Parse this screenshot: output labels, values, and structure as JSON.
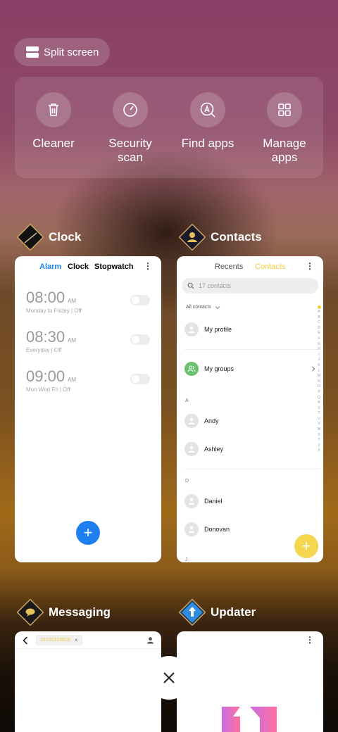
{
  "split_screen": {
    "label": "Split screen"
  },
  "tools": [
    {
      "label": "Cleaner",
      "icon": "trash-icon"
    },
    {
      "label": "Security\nscan",
      "icon": "gauge-icon"
    },
    {
      "label": "Find apps",
      "icon": "find-apps-icon"
    },
    {
      "label": "Manage\napps",
      "icon": "grid-icon"
    }
  ],
  "apps": {
    "clock": {
      "title": "Clock",
      "tabs": [
        "Alarm",
        "Clock",
        "Stopwatch"
      ],
      "alarms": [
        {
          "time": "08:00",
          "ampm": "AM",
          "days": "Monday to Friday | Off"
        },
        {
          "time": "08:30",
          "ampm": "AM",
          "days": "Everyday | Off"
        },
        {
          "time": "09:00",
          "ampm": "AM",
          "days": "Mon Wed Fri | Off"
        }
      ],
      "accent": "#1e80f0"
    },
    "contacts": {
      "title": "Contacts",
      "tabs": [
        "Recents",
        "Contacts"
      ],
      "search_placeholder": "17 contacts",
      "filter": "All contacts",
      "my_profile": "My profile",
      "my_groups": "My groups",
      "sections": [
        {
          "letter": "A",
          "names": [
            "Andy",
            "Ashley"
          ]
        },
        {
          "letter": "D",
          "names": [
            "Daniel",
            "Donovan"
          ]
        }
      ],
      "next_letter": "J",
      "index_letters": [
        "A",
        "B",
        "C",
        "D",
        "E",
        "F",
        "G",
        "H",
        "I",
        "J",
        "K",
        "L",
        "M",
        "N",
        "O",
        "P",
        "Q",
        "R",
        "S",
        "T",
        "U",
        "V",
        "W",
        "X",
        "Y",
        "Z",
        "#"
      ],
      "accent": "#f5cc3a"
    },
    "messaging": {
      "title": "Messaging",
      "recipient": "16700316826"
    },
    "updater": {
      "title": "Updater"
    }
  }
}
